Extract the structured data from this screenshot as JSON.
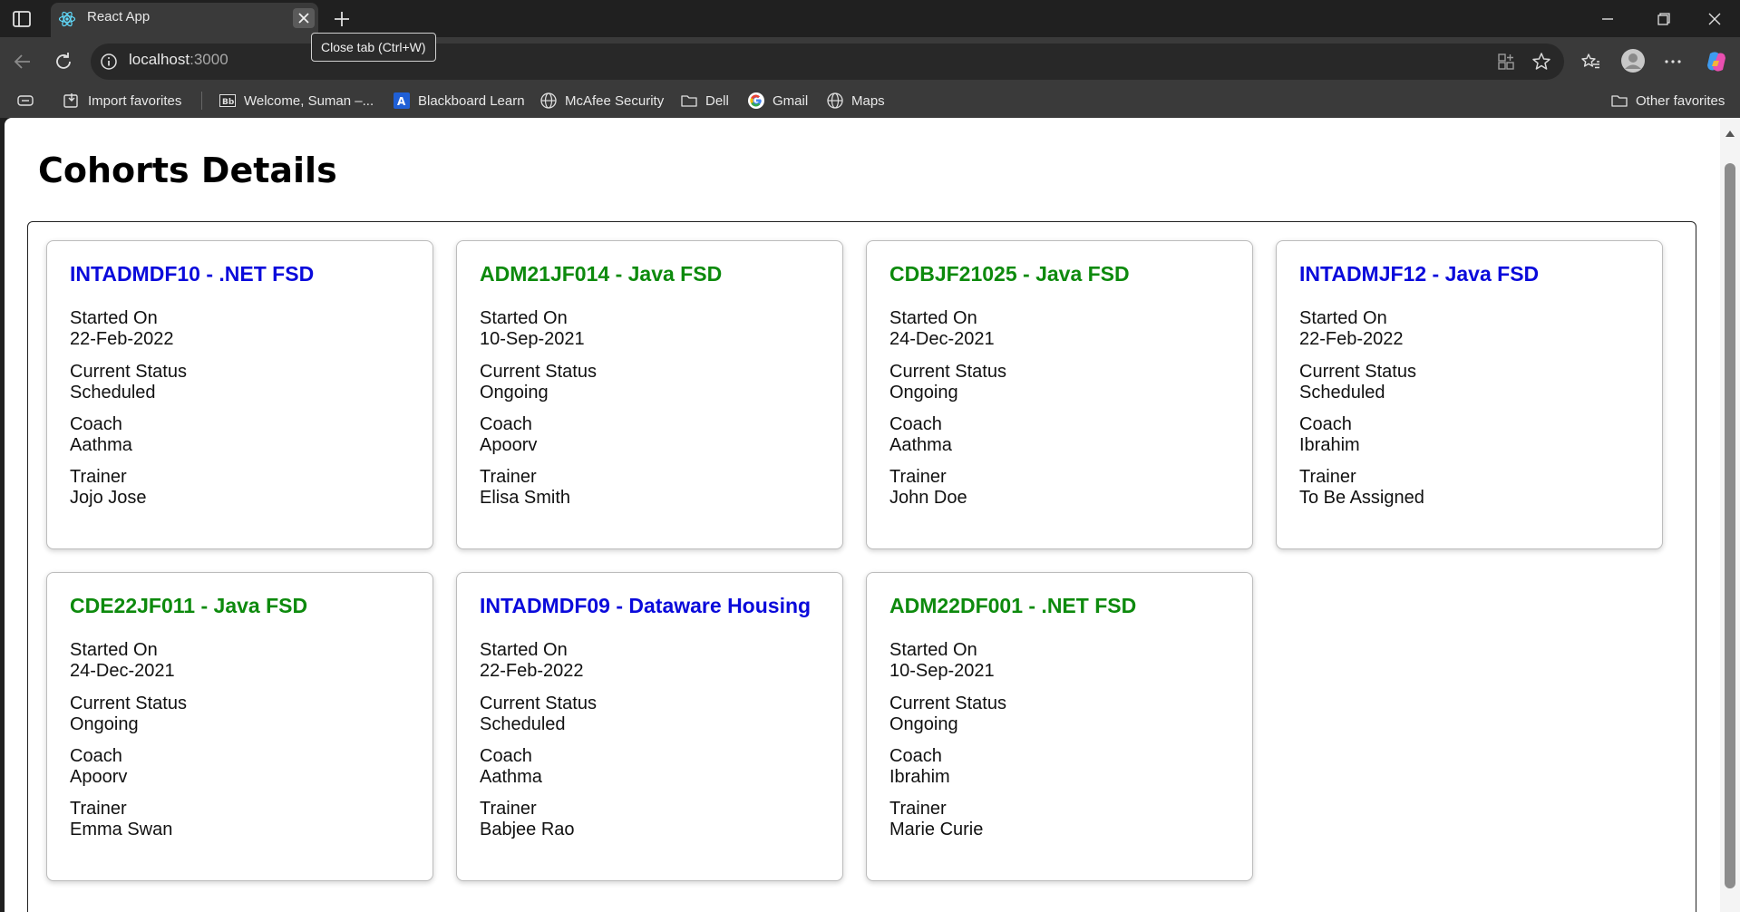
{
  "browser": {
    "tab_title": "React App",
    "tooltip": "Close tab (Ctrl+W)",
    "url_host": "localhost",
    "url_port": ":3000",
    "bookmarks": [
      {
        "label": "Import favorites",
        "icon": "import-icon"
      },
      {
        "label": "Welcome, Suman –...",
        "icon": "blackboard-bb-icon"
      },
      {
        "label": "Blackboard Learn",
        "icon": "blackboard-learn-icon"
      },
      {
        "label": "McAfee Security",
        "icon": "globe-icon"
      },
      {
        "label": "Dell",
        "icon": "folder-icon"
      },
      {
        "label": "Gmail",
        "icon": "google-icon"
      },
      {
        "label": "Maps",
        "icon": "globe-icon"
      }
    ],
    "other_favorites": "Other favorites"
  },
  "page": {
    "title": "Cohorts Details",
    "labels": {
      "started": "Started On",
      "status": "Current Status",
      "coach": "Coach",
      "trainer": "Trainer"
    },
    "colors": {
      "scheduled": "#0a0adb",
      "ongoing": "#0d8a0d"
    },
    "cohorts": [
      {
        "title": "INTADMDF10 - .NET FSD",
        "started": "22-Feb-2022",
        "status": "Scheduled",
        "coach": "Aathma",
        "trainer": "Jojo Jose"
      },
      {
        "title": "ADM21JF014 - Java FSD",
        "started": "10-Sep-2021",
        "status": "Ongoing",
        "coach": "Apoorv",
        "trainer": "Elisa Smith"
      },
      {
        "title": "CDBJF21025 - Java FSD",
        "started": "24-Dec-2021",
        "status": "Ongoing",
        "coach": "Aathma",
        "trainer": "John Doe"
      },
      {
        "title": "INTADMJF12 - Java FSD",
        "started": "22-Feb-2022",
        "status": "Scheduled",
        "coach": "Ibrahim",
        "trainer": "To Be Assigned"
      },
      {
        "title": "CDE22JF011 - Java FSD",
        "started": "24-Dec-2021",
        "status": "Ongoing",
        "coach": "Apoorv",
        "trainer": "Emma Swan"
      },
      {
        "title": "INTADMDF09 - Dataware Housing",
        "started": "22-Feb-2022",
        "status": "Scheduled",
        "coach": "Aathma",
        "trainer": "Babjee Rao"
      },
      {
        "title": "ADM22DF001 - .NET FSD",
        "started": "10-Sep-2021",
        "status": "Ongoing",
        "coach": "Ibrahim",
        "trainer": "Marie Curie"
      }
    ]
  }
}
